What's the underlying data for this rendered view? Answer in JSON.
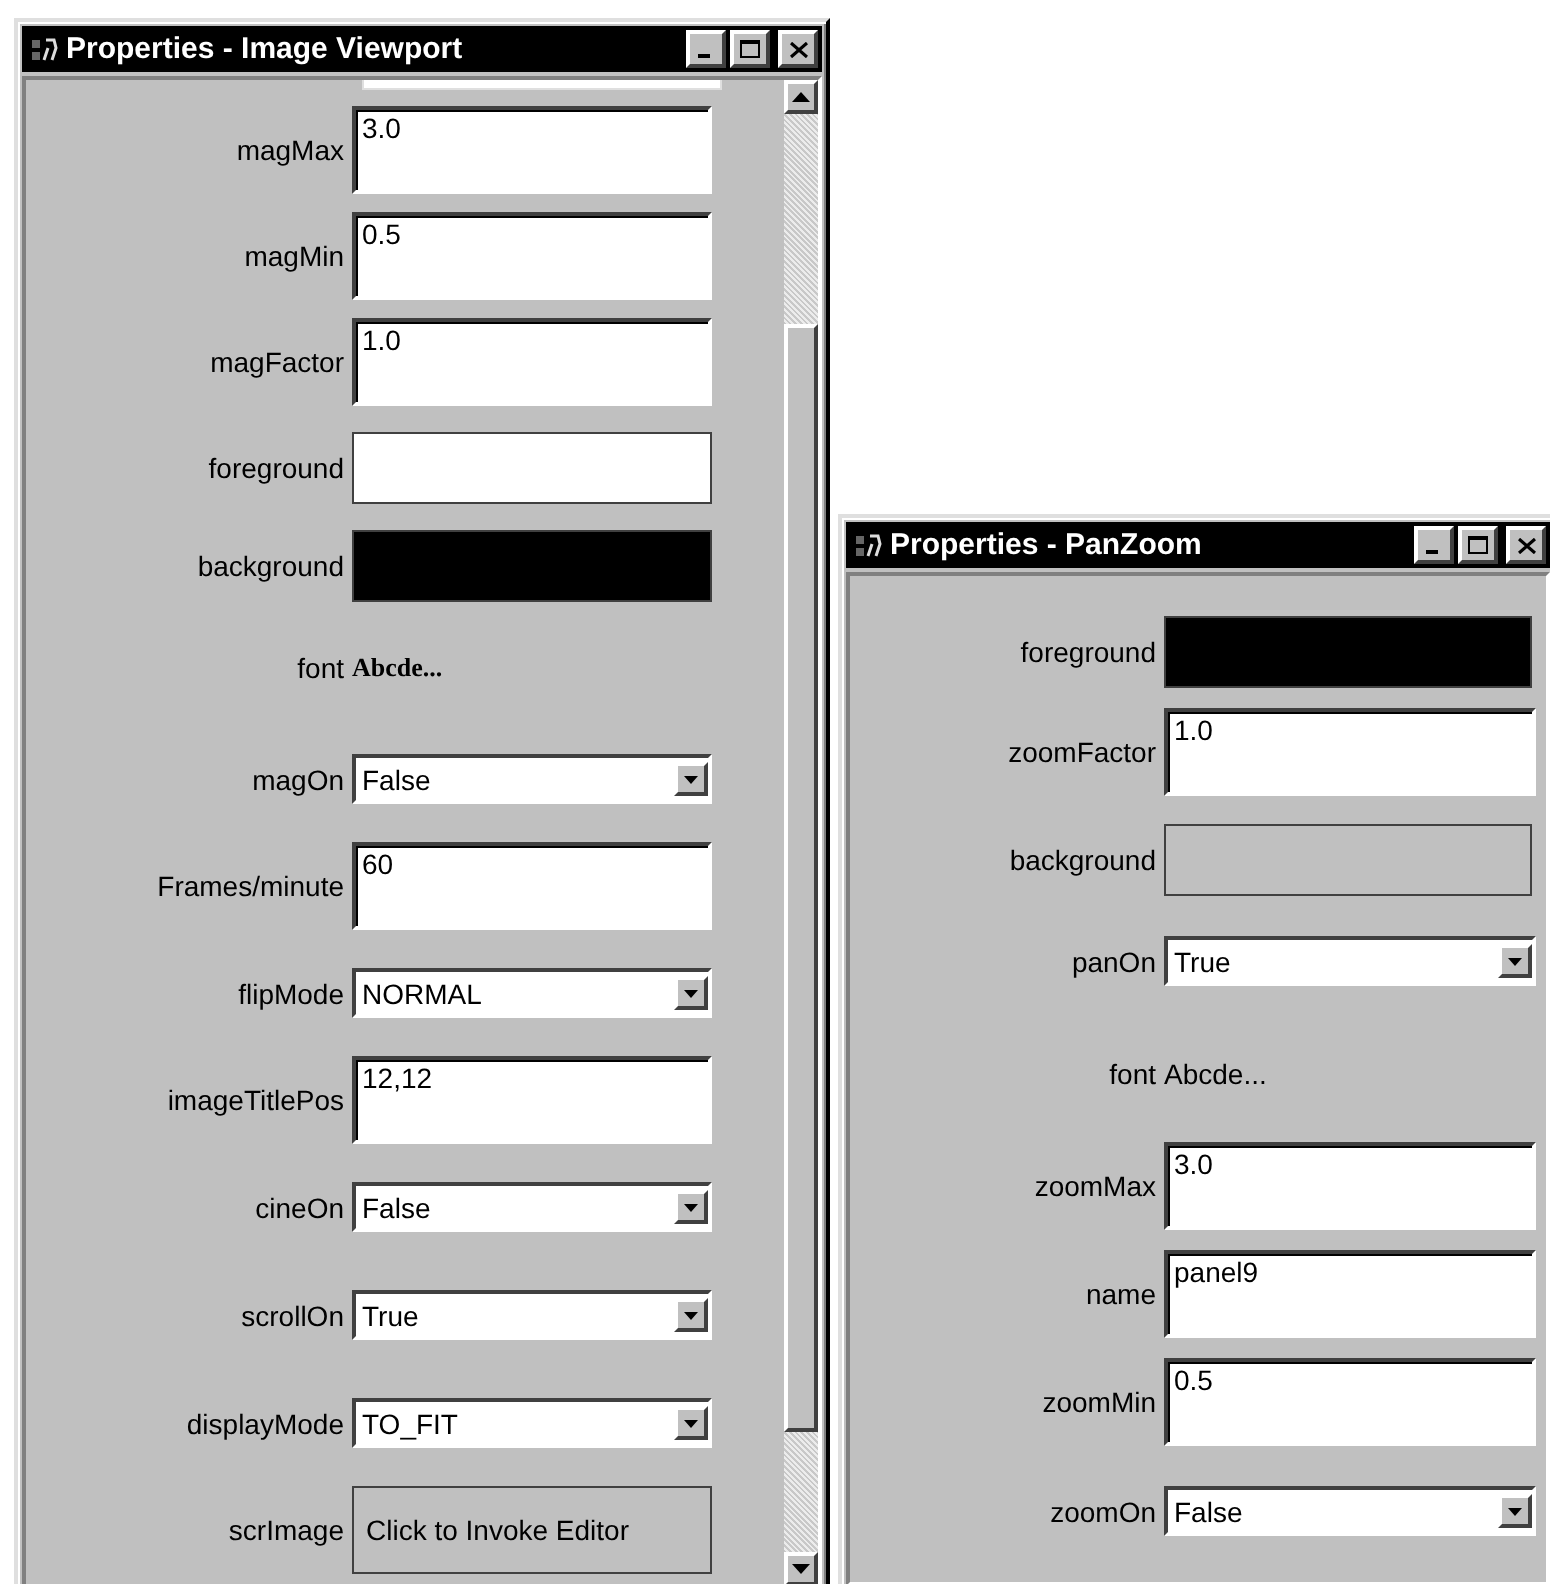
{
  "windows": [
    {
      "title": "Properties - Image Viewport",
      "scrollbar": true,
      "properties": [
        {
          "kind": "cut"
        },
        {
          "kind": "text",
          "label": "magMax",
          "value": "3.0"
        },
        {
          "kind": "text",
          "label": "magMin",
          "value": "0.5"
        },
        {
          "kind": "text",
          "label": "magFactor",
          "value": "1.0"
        },
        {
          "kind": "color",
          "label": "foreground",
          "color": "#ffffff"
        },
        {
          "kind": "color",
          "label": "background",
          "color": "#000000"
        },
        {
          "kind": "font",
          "label": "font",
          "sample": "Abcde...",
          "bold": true
        },
        {
          "kind": "select",
          "label": "magOn",
          "value": "False"
        },
        {
          "kind": "text",
          "label": "Frames/minute",
          "value": "60"
        },
        {
          "kind": "select",
          "label": "flipMode",
          "value": "NORMAL"
        },
        {
          "kind": "text",
          "label": "imageTitlePos",
          "value": "12,12"
        },
        {
          "kind": "select",
          "label": "cineOn",
          "value": "False"
        },
        {
          "kind": "select",
          "label": "scrollOn",
          "value": "True"
        },
        {
          "kind": "select",
          "label": "displayMode",
          "value": "TO_FIT"
        },
        {
          "kind": "editor",
          "label": "scrImage",
          "value": "Click to Invoke Editor"
        }
      ]
    },
    {
      "title": "Properties - PanZoom",
      "scrollbar": false,
      "properties": [
        {
          "kind": "color",
          "label": "foreground",
          "color": "#000000"
        },
        {
          "kind": "text",
          "label": "zoomFactor",
          "value": "1.0"
        },
        {
          "kind": "color",
          "label": "background",
          "color": "#c0c0c0"
        },
        {
          "kind": "select",
          "label": "panOn",
          "value": "True"
        },
        {
          "kind": "font",
          "label": "font",
          "sample": "Abcde...",
          "bold": false
        },
        {
          "kind": "text",
          "label": "zoomMax",
          "value": "3.0"
        },
        {
          "kind": "text",
          "label": "name",
          "value": "panel9"
        },
        {
          "kind": "text",
          "label": "zoomMin",
          "value": "0.5"
        },
        {
          "kind": "select",
          "label": "zoomOn",
          "value": "False"
        }
      ]
    }
  ]
}
